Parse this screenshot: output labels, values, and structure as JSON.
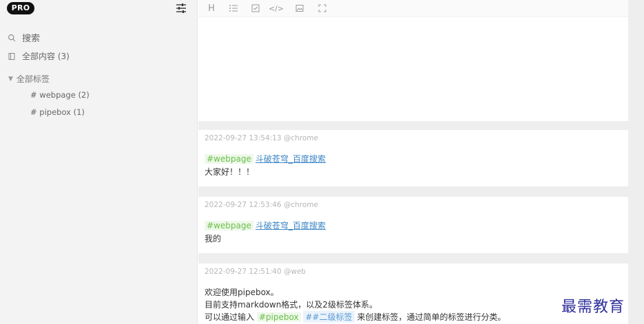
{
  "sidebar": {
    "brand": "PRO",
    "search_label": "搜索",
    "all_label": "全部内容 (3)",
    "tags_label": "全部标签",
    "tags": [
      "# webpage (2)",
      "# pipebox (1)"
    ]
  },
  "toolbar": {
    "heading": "H",
    "list": "list-icon",
    "checkbox": "checkbox-icon",
    "code": "</>",
    "image": "image-icon",
    "fullscreen": "fullscreen-icon"
  },
  "cards": [
    {
      "meta": "2022-09-27 13:54:13 @chrome",
      "tag": "#webpage",
      "link": "斗破苍穹_百度搜索",
      "text": "大家好！！！"
    },
    {
      "meta": "2022-09-27 12:53:46 @chrome",
      "tag": "#webpage",
      "link": "斗破苍穹_百度搜索",
      "text": "我的"
    },
    {
      "meta": "2022-09-27 12:51:40 @web",
      "line1": "欢迎使用pipebox。",
      "line2": "目前支持markdown格式，以及2级标签体系。",
      "line3_a": "可以通过输入",
      "line3_tag1": "#pipebox",
      "line3_tag2": "##二级标签",
      "line3_b": "来创建标签，通过简单的标签进行分类。"
    }
  ],
  "watermark": "最需教育",
  "colors": {
    "tag_green": "#6bc04b",
    "link_blue": "#3f87c6",
    "meta_gray": "#b6b6b6"
  }
}
